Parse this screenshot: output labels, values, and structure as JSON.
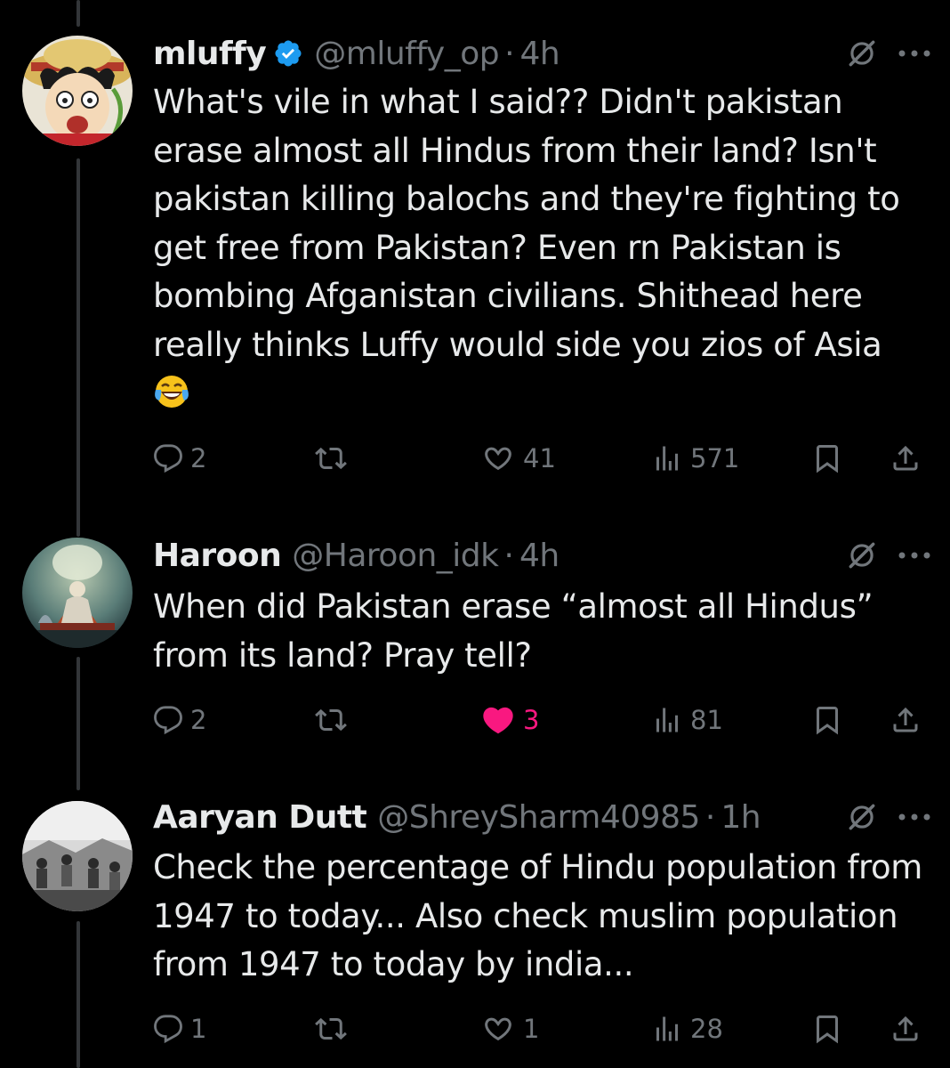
{
  "colors": {
    "background": "#000000",
    "text": "#e7e9ea",
    "secondary": "#71767b",
    "verified": "#1d9bf0",
    "like_active": "#f91880",
    "thread_line": "#333639"
  },
  "tweets": [
    {
      "display_name": "mluffy",
      "verified": true,
      "handle": "@mluffy_op",
      "separator": "·",
      "time": "4h",
      "text_before_emoji": "What's vile in what I said?? Didn't pakistan erase almost all Hindus from their land? Isn't pakistan killing balochs and they're fighting to get free from Pakistan? Even rn Pakistan is bombing Afganistan civilians. Shithead here really thinks Luffy would side you zios of Asia ",
      "emoji": "face-with-tears-of-joy",
      "replies": "2",
      "retweets": "",
      "likes": "41",
      "liked": false,
      "views": "571"
    },
    {
      "display_name": "Haroon",
      "verified": false,
      "handle": "@Haroon_idk",
      "separator": "·",
      "time": "4h",
      "text": "When did Pakistan erase “almost all Hindus” from its land? Pray tell?",
      "replies": "2",
      "retweets": "",
      "likes": "3",
      "liked": true,
      "views": "81"
    },
    {
      "display_name": "Aaryan Dutt",
      "verified": false,
      "handle": "@ShreySharm40985",
      "separator": "·",
      "time": "1h",
      "text": "Check the percentage of Hindu population from 1947 to today... Also check muslim population from 1947 to today by india...",
      "replies": "1",
      "retweets": "",
      "likes": "1",
      "liked": false,
      "views": "28"
    }
  ]
}
